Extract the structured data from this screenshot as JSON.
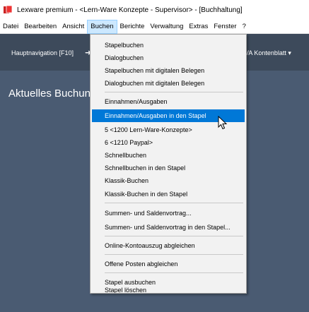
{
  "window": {
    "title": "Lexware premium - <Lern-Ware Konzepte - Supervisor> - [Buchhaltung]"
  },
  "menubar": {
    "items": [
      "Datei",
      "Bearbeiten",
      "Ansicht",
      "Buchen",
      "Berichte",
      "Verwaltung",
      "Extras",
      "Fenster",
      "?"
    ],
    "active": "Buchen"
  },
  "toolbar": {
    "hauptnavigation": "Hauptnavigation [F10]",
    "arrow": "➜",
    "right_label": "VA Kontenblatt ▾"
  },
  "content": {
    "title": "Aktuelles Buchung"
  },
  "dropdown": {
    "items": [
      "Stapelbuchen",
      "Dialogbuchen",
      "Stapelbuchen mit digitalen Belegen",
      "Dialogbuchen mit digitalen Belegen",
      "Einnahmen/Ausgaben",
      "Einnahmen/Ausgaben in den Stapel",
      "5  <1200 Lern-Ware-Konzepte>",
      "6  <1210 Paypal>",
      "Schnellbuchen",
      "Schnellbuchen in den Stapel",
      "Klassik-Buchen",
      "Klassik-Buchen in den Stapel",
      "Summen- und Saldenvortrag...",
      "Summen- und Saldenvortrag in den Stapel...",
      "Online-Kontoauszug abgleichen",
      "Offene Posten abgleichen",
      "Stapel ausbuchen",
      "Stapel löschen"
    ],
    "highlighted_index": 5
  },
  "colors": {
    "toolbar_bg": "#3d4a5b",
    "content_bg": "#4a5b72",
    "highlight": "#0078d7",
    "menu_active": "#cce8ff"
  }
}
